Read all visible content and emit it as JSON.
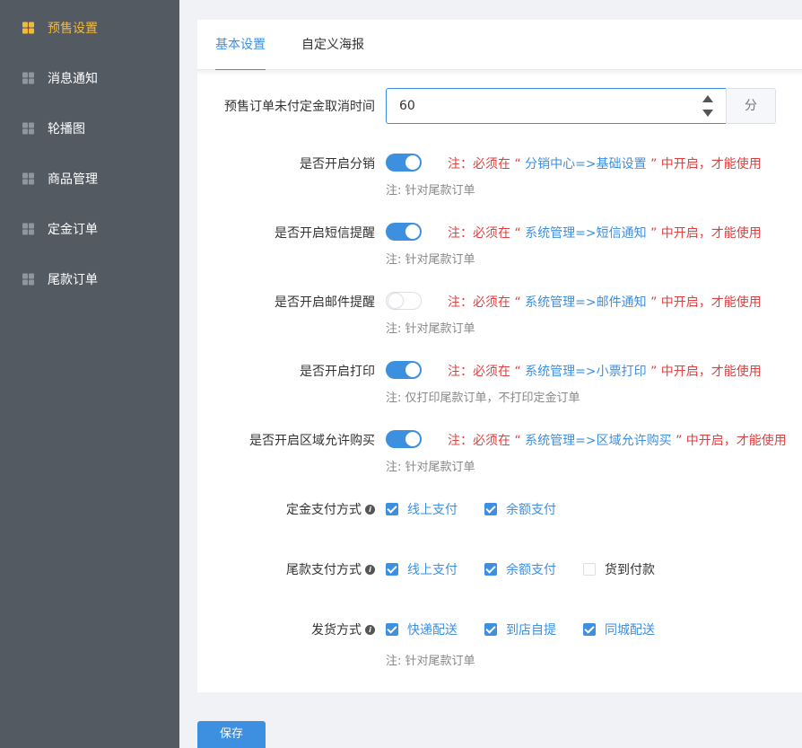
{
  "sidebar": {
    "items": [
      {
        "label": "预售设置",
        "icon": "grid-icon",
        "active": true
      },
      {
        "label": "消息通知",
        "icon": "grid-icon"
      },
      {
        "label": "轮播图",
        "icon": "grid-icon"
      },
      {
        "label": "商品管理",
        "icon": "grid-icon"
      },
      {
        "label": "定金订单",
        "icon": "grid-icon"
      },
      {
        "label": "尾款订单",
        "icon": "grid-icon"
      }
    ]
  },
  "tabs": [
    {
      "label": "基本设置",
      "active": true
    },
    {
      "label": "自定义海报",
      "active": false
    }
  ],
  "form": {
    "cancel_time": {
      "label": "预售订单未付定金取消时间",
      "value": "60",
      "unit": "分"
    },
    "toggles": [
      {
        "label": "是否开启分销",
        "on": true,
        "note_prefix": "注：必须在 “ ",
        "note_link": "分销中心=>基础设置",
        "note_suffix": " ” 中开启，才能使用",
        "sub_note": "注: 针对尾款订单"
      },
      {
        "label": "是否开启短信提醒",
        "on": true,
        "note_prefix": "注：必须在 “ ",
        "note_link": "系统管理=>短信通知",
        "note_suffix": " ” 中开启，才能使用",
        "sub_note": "注: 针对尾款订单"
      },
      {
        "label": "是否开启邮件提醒",
        "on": false,
        "note_prefix": "注：必须在 “ ",
        "note_link": "系统管理=>邮件通知",
        "note_suffix": " ” 中开启，才能使用",
        "sub_note": "注: 针对尾款订单"
      },
      {
        "label": "是否开启打印",
        "on": true,
        "note_prefix": "注：必须在 “ ",
        "note_link": "系统管理=>小票打印",
        "note_suffix": " ” 中开启，才能使用",
        "sub_note": "注: 仅打印尾款订单，不打印定金订单"
      },
      {
        "label": "是否开启区域允许购买",
        "on": true,
        "note_prefix": "注：必须在 “ ",
        "note_link": "系统管理=>区域允许购买",
        "note_suffix": " ” 中开启，才能使用",
        "sub_note": "注: 针对尾款订单"
      }
    ],
    "deposit_pay": {
      "label": "定金支付方式",
      "options": [
        {
          "label": "线上支付",
          "checked": true
        },
        {
          "label": "余额支付",
          "checked": true
        }
      ]
    },
    "final_pay": {
      "label": "尾款支付方式",
      "options": [
        {
          "label": "线上支付",
          "checked": true
        },
        {
          "label": "余额支付",
          "checked": true
        },
        {
          "label": "货到付款",
          "checked": false
        }
      ]
    },
    "delivery": {
      "label": "发货方式",
      "options": [
        {
          "label": "快递配送",
          "checked": true
        },
        {
          "label": "到店自提",
          "checked": true
        },
        {
          "label": "同城配送",
          "checked": true
        }
      ],
      "sub_note": "注: 针对尾款订单"
    }
  },
  "save_label": "保存",
  "colors": {
    "accent": "#3d8fe0",
    "sidebar_bg": "#535a62",
    "active_nav": "#f3b93c",
    "warning": "#e23e3e"
  }
}
